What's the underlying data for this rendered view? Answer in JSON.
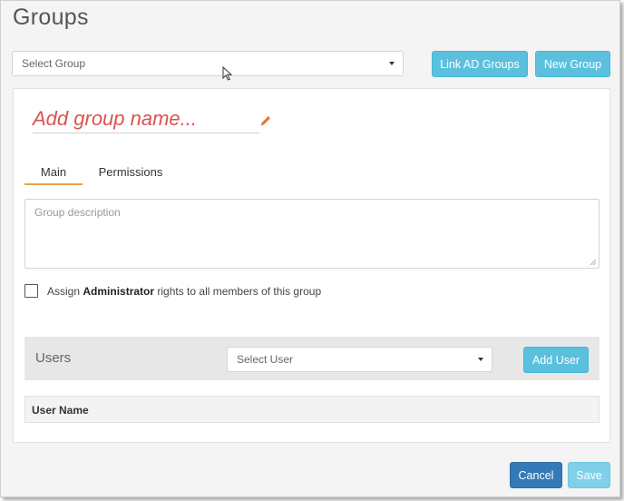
{
  "page": {
    "title": "Groups"
  },
  "toolbar": {
    "group_select": "Select Group",
    "link_ad_label": "Link AD Groups",
    "new_group_label": "New Group"
  },
  "group": {
    "name_placeholder": "Add group name...",
    "tabs": [
      {
        "label": "Main",
        "active": true
      },
      {
        "label": "Permissions",
        "active": false
      }
    ],
    "description_placeholder": "Group description",
    "admin_prefix": "Assign ",
    "admin_bold": "Administrator",
    "admin_suffix": " rights to all members of this group",
    "admin_checked": false
  },
  "users": {
    "title": "Users",
    "select_placeholder": "Select User",
    "add_label": "Add User",
    "columns": [
      "User Name"
    ],
    "rows": []
  },
  "footer": {
    "cancel_label": "Cancel",
    "save_label": "Save"
  },
  "colors": {
    "accent": "#5bc0de",
    "primary": "#337ab7",
    "tab_underline": "#f0a040",
    "placeholder_red": "#d9534f",
    "pencil": "#e8762c"
  }
}
